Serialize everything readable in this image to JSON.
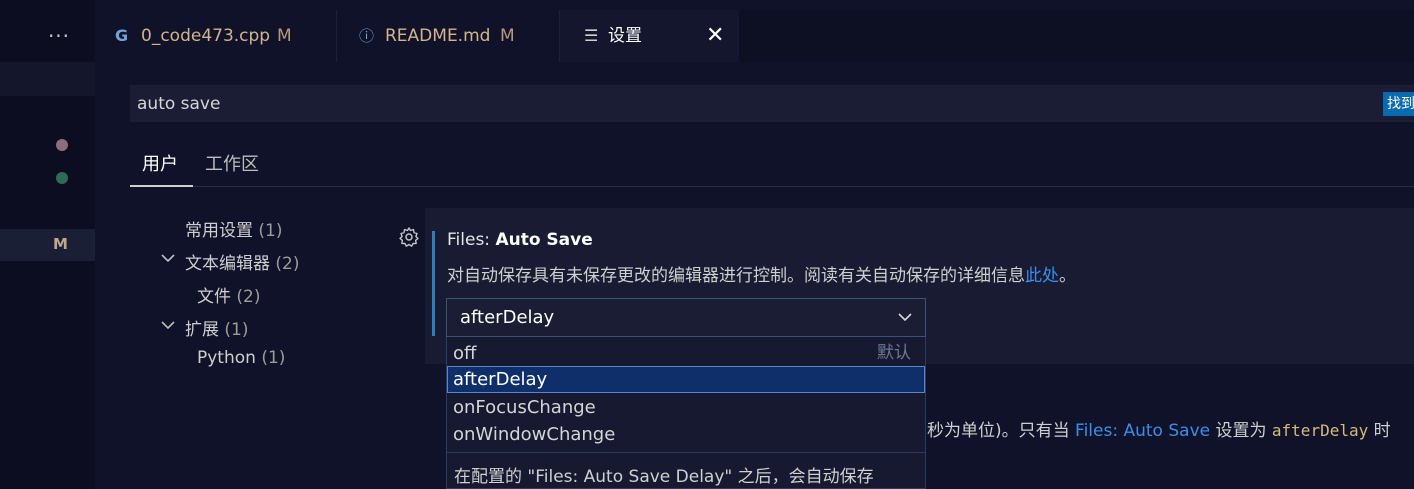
{
  "activity": {
    "more_icon": "ellipsis-icon",
    "modified_badge": "M"
  },
  "tabs": [
    {
      "icon": "cpp-icon",
      "icon_glyph": "G",
      "label": "0_code473.cpp",
      "modified": "M"
    },
    {
      "icon": "info-icon",
      "icon_glyph": "ⓘ",
      "label": "README.md",
      "modified": "M"
    },
    {
      "icon": "settings-file-icon",
      "icon_glyph": "☰",
      "label": "设置",
      "close": "✕"
    }
  ],
  "search": {
    "value": "auto save",
    "found_label": "找到"
  },
  "scope_tabs": [
    {
      "label": "用户",
      "active": true
    },
    {
      "label": "工作区",
      "active": false
    }
  ],
  "toc": [
    {
      "label": "常用设置",
      "count": "(1)"
    },
    {
      "label": "文本编辑器",
      "count": "(2)",
      "expanded": true
    },
    {
      "label": "文件",
      "count": "(2)"
    },
    {
      "label": "扩展",
      "count": "(1)",
      "expanded": true
    },
    {
      "label": "Python",
      "count": "(1)"
    }
  ],
  "setting": {
    "category": "Files: ",
    "name": "Auto Save",
    "description": "对自动保存具有未保存更改的编辑器进行控制。阅读有关自动保存的详细信息",
    "link_text": "此处",
    "description_end": "。",
    "selected": "afterDelay",
    "options": [
      {
        "label": "off",
        "default_label": "默认"
      },
      {
        "label": "afterDelay",
        "selected": true
      },
      {
        "label": "onFocusChange"
      },
      {
        "label": "onWindowChange"
      }
    ],
    "option_description": "在配置的 \"Files: Auto Save Delay\" 之后，会自动保存"
  },
  "setting2": {
    "text_before": "秒为单位)。只有当 ",
    "link": "Files: Auto Save",
    "text_mid": " 设置为 ",
    "code": "afterDelay",
    "text_after": " 时"
  },
  "colors": {
    "accent": "#3b8eea",
    "modified": "#d3b48c",
    "selection": "#0f2f6b",
    "found_badge": "#0a6ab1"
  }
}
